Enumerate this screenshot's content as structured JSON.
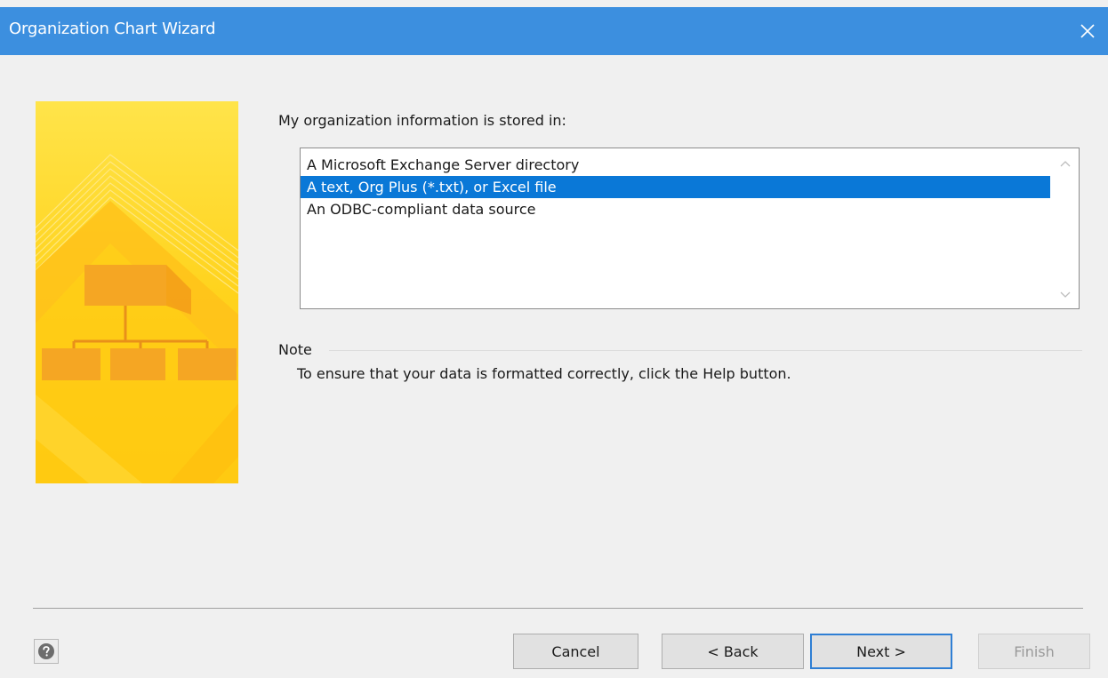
{
  "window": {
    "title": "Organization Chart Wizard",
    "close_icon": "close-icon",
    "titlebar_color": "#3c8fdf"
  },
  "main": {
    "prompt": "My organization information is stored in:",
    "options": [
      {
        "label": "A Microsoft Exchange Server directory",
        "selected": false
      },
      {
        "label": "A text, Org Plus (*.txt), or Excel file",
        "selected": true
      },
      {
        "label": "An ODBC-compliant data source",
        "selected": false
      }
    ],
    "selection_color": "#0a78d7"
  },
  "note": {
    "heading": "Note",
    "text": "To ensure that your data is formatted correctly, click the Help button."
  },
  "footer": {
    "help_icon": "help-icon",
    "cancel_label": "Cancel",
    "back_label": "< Back",
    "next_label": "Next >",
    "finish_label": "Finish"
  },
  "banner": {
    "accent_color": "#ffd21a"
  }
}
